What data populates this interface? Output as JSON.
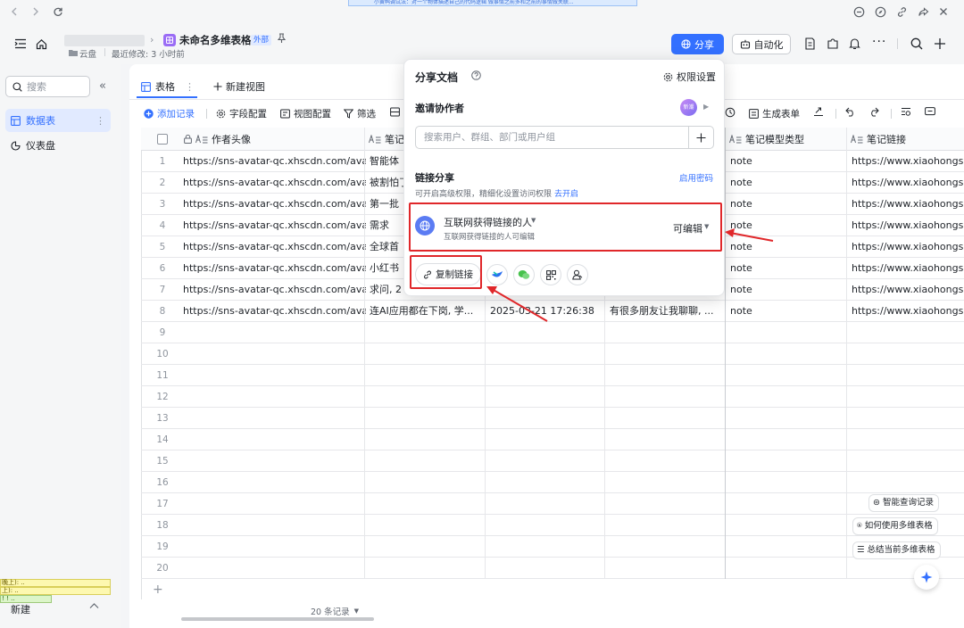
{
  "banner": {
    "text": "小黄鸭调试法：对一个物体描述自己的代码逻辑 做事情之前多和之前的事情做关联..."
  },
  "header": {
    "doc_title": "未命名多维表格",
    "external_badge": "外部",
    "location": "云盘",
    "last_modified": "最近修改: 3 小时前",
    "share_label": "分享",
    "automation_label": "自动化"
  },
  "sidebar": {
    "search_placeholder": "搜索",
    "items": [
      {
        "label": "数据表"
      },
      {
        "label": "仪表盘"
      }
    ],
    "new_label": "新建",
    "debug_lines": [
      "晚上):  ..",
      "上):  ..",
      "! ! .."
    ]
  },
  "view_tabs": {
    "table_tab": "表格",
    "new_view": "新建视图"
  },
  "toolbar": {
    "add_record": "添加记录",
    "field_config": "字段配置",
    "view_config": "视图配置",
    "filter": "筛选",
    "generate_form": "生成表单"
  },
  "table": {
    "columns": [
      "作者头像",
      "笔记",
      "笔记模型类型",
      "笔记链接"
    ],
    "rows": [
      {
        "num": "1",
        "avatar": "https://sns-avatar-qc.xhscdn.com/avat...",
        "note": "智能体",
        "time": "",
        "content": "",
        "type": "note",
        "link": "https://www.xiaohongs"
      },
      {
        "num": "2",
        "avatar": "https://sns-avatar-qc.xhscdn.com/avat...",
        "note": "被割怕了",
        "time": "",
        "content": "",
        "type": "note",
        "link": "https://www.xiaohongs"
      },
      {
        "num": "3",
        "avatar": "https://sns-avatar-qc.xhscdn.com/avat...",
        "note": "第一批",
        "time": "",
        "content": "",
        "type": "note",
        "link": "https://www.xiaohongs"
      },
      {
        "num": "4",
        "avatar": "https://sns-avatar-qc.xhscdn.com/avat...",
        "note": "需求",
        "time": "",
        "content": "",
        "type": "note",
        "link": "https://www.xiaohongs"
      },
      {
        "num": "5",
        "avatar": "https://sns-avatar-qc.xhscdn.com/avat...",
        "note": "全球首",
        "time": "",
        "content": "",
        "type": "note",
        "link": "https://www.xiaohongs"
      },
      {
        "num": "6",
        "avatar": "https://sns-avatar-qc.xhscdn.com/avat...",
        "note": "小红书",
        "time": "",
        "content": "",
        "type": "note",
        "link": "https://www.xiaohongs"
      },
      {
        "num": "7",
        "avatar": "https://sns-avatar-qc.xhscdn.com/avat...",
        "note": "求问, 2",
        "time": "",
        "content": "",
        "type": "note",
        "link": "https://www.xiaohongs"
      },
      {
        "num": "8",
        "avatar": "https://sns-avatar-qc.xhscdn.com/avat...",
        "note": "连AI应用都在下岗, 学...",
        "time": "2025-03-21 17:26:38",
        "content": "有很多朋友让我聊聊, ...",
        "type": "note",
        "link": "https://www.xiaohongs"
      },
      {
        "num": "9"
      },
      {
        "num": "10"
      },
      {
        "num": "11"
      },
      {
        "num": "12"
      },
      {
        "num": "13"
      },
      {
        "num": "14"
      },
      {
        "num": "15"
      },
      {
        "num": "16"
      },
      {
        "num": "17"
      },
      {
        "num": "18"
      },
      {
        "num": "19"
      },
      {
        "num": "20"
      }
    ],
    "record_count": "20 条记录"
  },
  "share_popup": {
    "title": "分享文档",
    "permission_settings": "权限设置",
    "invite_label": "邀请协作者",
    "avatar_text": "新潮",
    "search_placeholder": "搜索用户、群组、部门或用户组",
    "link_share_label": "链接分享",
    "enable_password": "启用密码",
    "advanced_hint": "可开启高级权限，精细化设置访问权限",
    "go_enable": "去开启",
    "scope_title": "互联网获得链接的人",
    "scope_desc": "互联网获得链接的人可编辑",
    "permission": "可编辑",
    "copy_link": "复制链接"
  },
  "fabs": {
    "smart_query": "智能查询记录",
    "how_to_use": "如何使用多维表格",
    "summarize": "总结当前多维表格"
  },
  "colors": {
    "accent": "#3370ff",
    "highlight_red": "#e0272a"
  }
}
